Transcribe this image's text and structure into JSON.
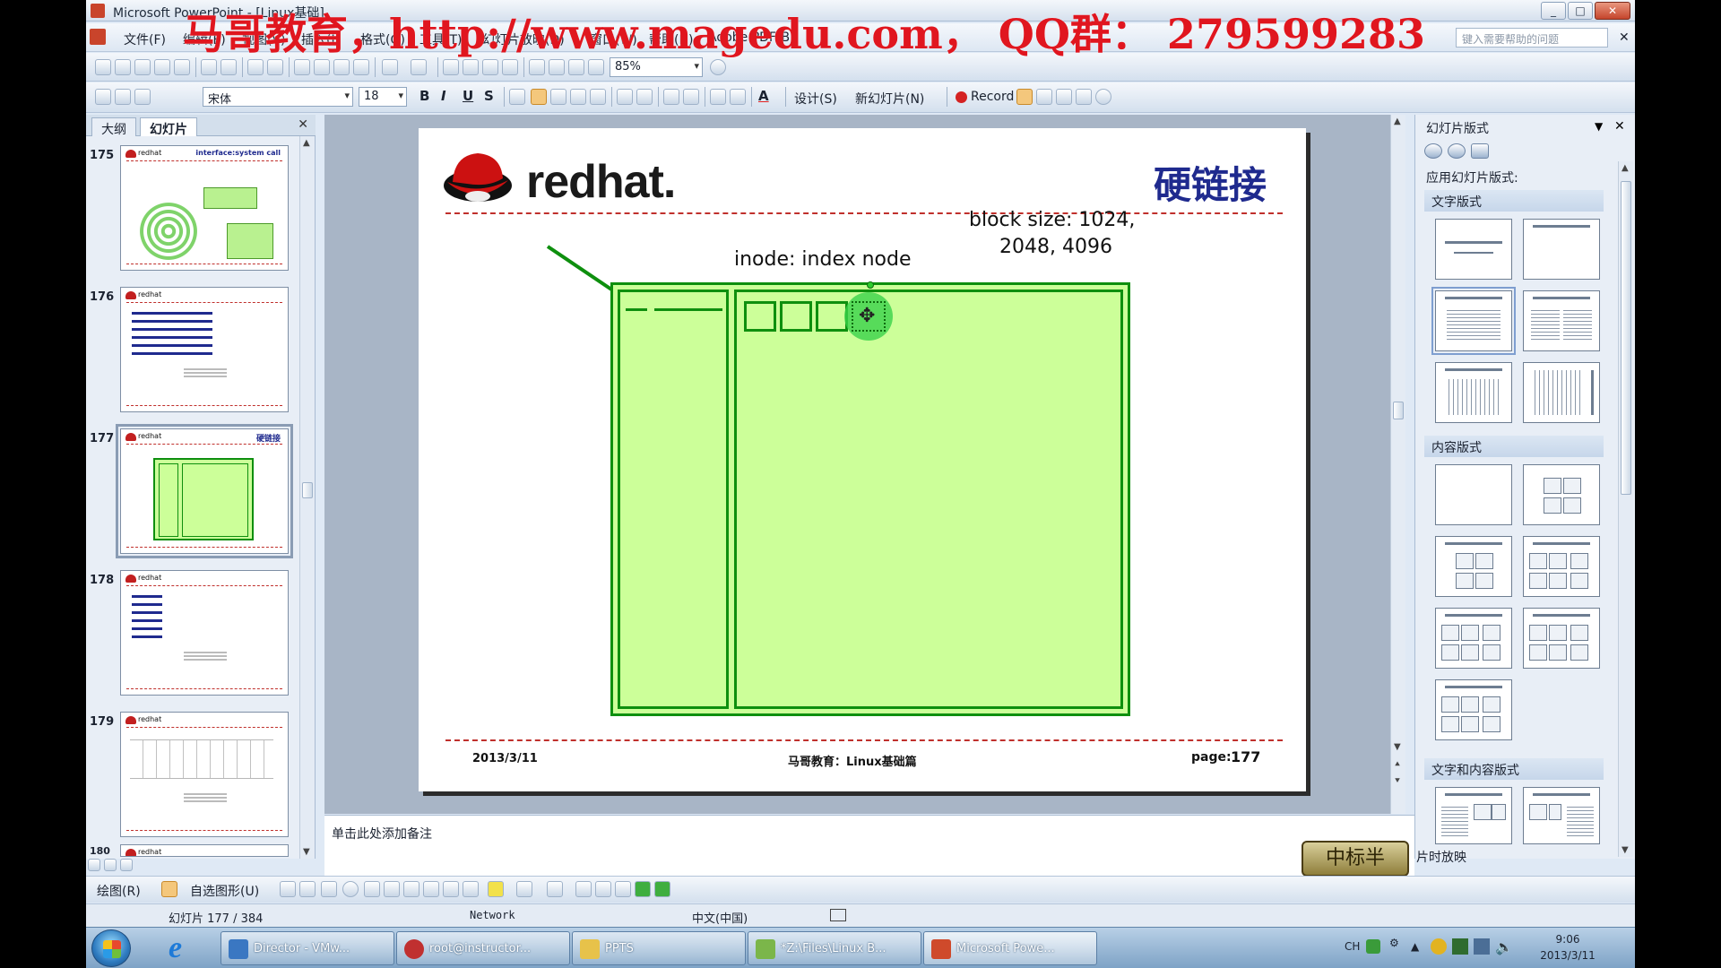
{
  "window": {
    "title": "Microsoft PowerPoint - [Linux基础]",
    "min": "_",
    "max": "□",
    "close": "✕"
  },
  "watermark": "马哥教育，http://www.magedu.com，  QQ群：  279599283",
  "menu": [
    "文件(F)",
    "编辑(E)",
    "视图(V)",
    "插入(I)",
    "格式(O)",
    "工具(T)",
    "幻灯片放映(D)",
    "窗口(W)",
    "帮助(H)",
    "Adobe PDF(B)"
  ],
  "help_search": "键入需要帮助的问题",
  "toolbar": {
    "zoom": "85%",
    "font": "宋体",
    "size": "18",
    "bold": "B",
    "italic": "I",
    "underline": "U",
    "shadow": "S",
    "design": "设计(S)",
    "new_slide": "新幻灯片(N)",
    "record": "Record"
  },
  "left_tabs": {
    "outline": "大纲",
    "slides": "幻灯片",
    "close": "✕"
  },
  "thumbnails": [
    {
      "num": "175",
      "title": "interface:system call"
    },
    {
      "num": "176",
      "title": ""
    },
    {
      "num": "177",
      "title": "硬链接"
    },
    {
      "num": "178",
      "title": ""
    },
    {
      "num": "179",
      "title": ""
    },
    {
      "num": "180",
      "title": ""
    }
  ],
  "slide": {
    "brand": "redhat.",
    "title": "硬链接",
    "block_size_line1": "block size: 1024,",
    "block_size_line2": "2048, 4096",
    "inode_label": "inode: index node",
    "footer_date": "2013/3/11",
    "footer_center": "马哥教育：Linux基础篇",
    "footer_page_label": "page:",
    "footer_page_num": "177"
  },
  "notes_placeholder": "单击此处添加备注",
  "taskpane": {
    "header": "幻灯片版式",
    "apply_label": "应用幻灯片版式:",
    "sections": [
      "文字版式",
      "内容版式",
      "文字和内容版式"
    ]
  },
  "stamp": {
    "seal": "中标半",
    "text": "片时放映"
  },
  "drawbar": {
    "draw": "绘图(R)",
    "autoshape": "自选图形(U)"
  },
  "status": {
    "slide": "幻灯片 177 / 384",
    "design": "Network",
    "lang": "中文(中国)"
  },
  "taskbar": {
    "items": [
      "Director - VMw...",
      "root@instructor...",
      "PPTS",
      "*Z:\\Files\\Linux B...",
      "Microsoft Powe..."
    ],
    "tray_lang": "CH",
    "time": "9:06",
    "date": "2013/3/11"
  },
  "colors": {
    "accent": "#1f2a8e",
    "slide_green": "#ccff99",
    "border_green": "#0e8f0e",
    "dash_red": "#c0302c",
    "watermark": "#e0161f"
  }
}
